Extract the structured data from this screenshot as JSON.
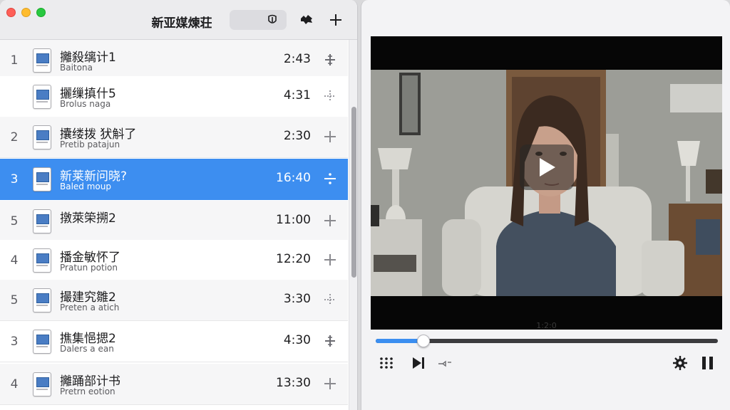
{
  "window_title": "新亚媒煉荘",
  "playlist": [
    {
      "num": "1",
      "title": "攡殺缡计1",
      "sub": "Baitona",
      "duration": "2:43",
      "action_icon": "plus-dashed-icon"
    },
    {
      "num": "",
      "title": "攦缫搷什5",
      "sub": "Brolus naga",
      "duration": "4:31",
      "action_icon": "dotted-plus-icon"
    },
    {
      "num": "2",
      "title": "攮缕拨 犾斛了",
      "sub": "Pretib patajun",
      "duration": "2:30",
      "action_icon": "plus-icon"
    },
    {
      "num": "3",
      "title": "新莱新问晓?",
      "sub": "Baled moup",
      "duration": "16:40",
      "action_icon": "divide-icon",
      "selected": true
    },
    {
      "num": "5",
      "title": "撴萊筞搠2",
      "sub": "",
      "duration": "11:00",
      "action_icon": "plus-icon"
    },
    {
      "num": "4",
      "title": "播金敏怀了",
      "sub": "Pratun potion",
      "duration": "12:20",
      "action_icon": "plus-icon"
    },
    {
      "num": "5",
      "title": "撮建究雛2",
      "sub": "Preten a atich",
      "duration": "3:30",
      "action_icon": "dotted-plus-icon"
    },
    {
      "num": "3",
      "title": "撨集悒揌2",
      "sub": "Dalers a ean",
      "duration": "4:30",
      "action_icon": "plus-dashed-icon"
    },
    {
      "num": "4",
      "title": "攡踊部计书",
      "sub": "Pretrn eotion",
      "duration": "13:30",
      "action_icon": "plus-icon"
    }
  ],
  "player": {
    "timestamp": "1:2:0",
    "progress": 0.14
  },
  "colors": {
    "selection": "#3d8ef0",
    "progress_fill": "#3b8ef0",
    "traffic_red": "#fe5f57",
    "traffic_yellow": "#febc2e",
    "traffic_green": "#28c840"
  },
  "icons": {
    "search_button": "search-shield-icon",
    "toolbar_shape": "puzzle-icon",
    "toolbar_add": "plus-icon",
    "grid": "grid-dots-icon",
    "next": "skip-next-icon",
    "volume": "volume-icon",
    "settings": "gear-icon",
    "pause": "pause-icon",
    "play": "play-icon"
  }
}
